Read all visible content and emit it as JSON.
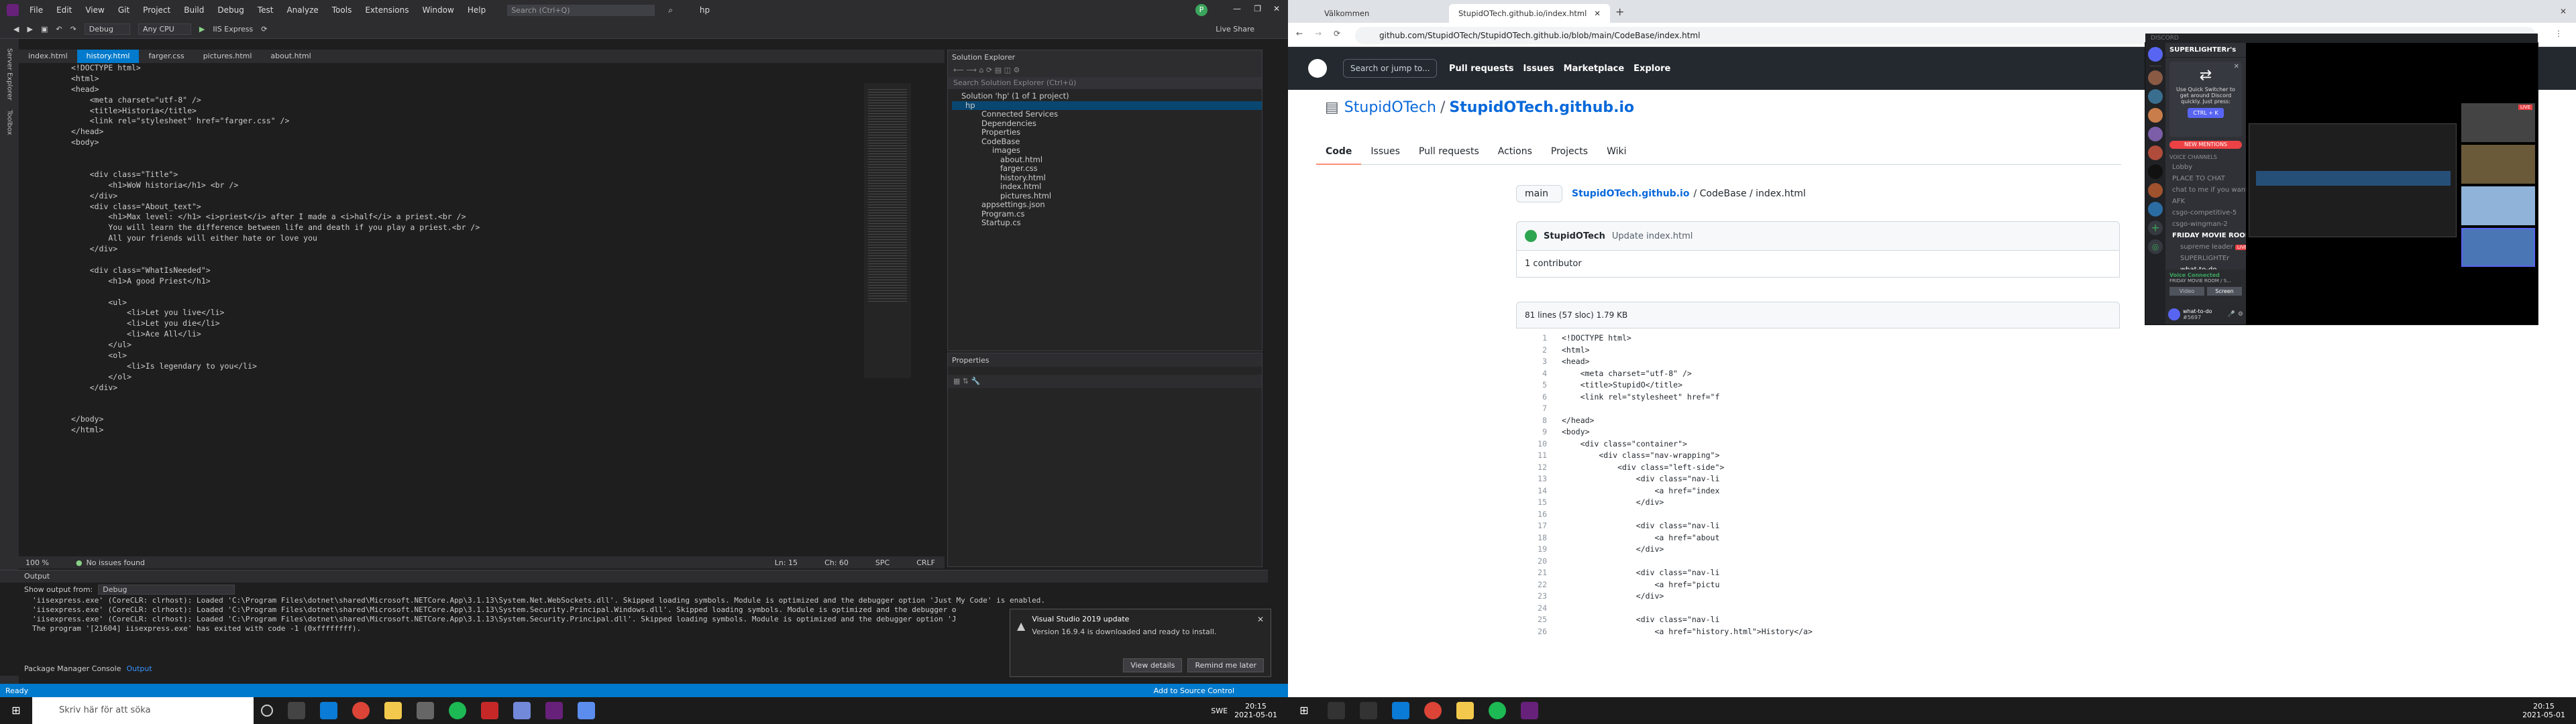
{
  "vs": {
    "menu": [
      "File",
      "Edit",
      "View",
      "Git",
      "Project",
      "Build",
      "Debug",
      "Test",
      "Analyze",
      "Tools",
      "Extensions",
      "Window",
      "Help"
    ],
    "search_placeholder": "Search (Ctrl+Q)",
    "solution_name": "hp",
    "toolbar": {
      "config": "Debug",
      "platform": "Any CPU",
      "run": "IIS Express",
      "live_share": "Live Share"
    },
    "side_tabs": [
      "Server Explorer",
      "Toolbox"
    ],
    "tabs": [
      "index.html",
      "history.html",
      "farger.css",
      "pictures.html",
      "about.html"
    ],
    "code_lines": [
      "<!DOCTYPE html>",
      "<html>",
      "<head>",
      "    <meta charset=\"utf-8\" />",
      "    <title>Historia</title>",
      "    <link rel=\"stylesheet\" href=\"farger.css\" />",
      "</head>",
      "<body>",
      "",
      "",
      "    <div class=\"Title\">",
      "        <h1>WoW historia</h1> <br />",
      "    </div>",
      "    <div class=\"About_text\">",
      "        <h1>Max level: </h1> <i>priest</i> after I made a <i>half</i> a priest.<br />",
      "        You will learn the difference between life and death if you play a priest.<br />",
      "        All your friends will either hate or love you",
      "    </div>",
      "",
      "    <div class=\"WhatIsNeeded\">",
      "        <h1>A good Priest</h1>",
      "",
      "        <ul>",
      "            <li>Let you live</li>",
      "            <li>Let you die</li>",
      "            <li>Ace All</li>",
      "        </ul>",
      "        <ol>",
      "            <li>Is legendary to you</li>",
      "        </ol>",
      "    </div>",
      "",
      "",
      "</body>",
      "</html>"
    ],
    "editor_status": {
      "zoom": "100 %",
      "issues": "No issues found",
      "ln": "Ln: 15",
      "ch": "Ch: 60",
      "spc": "SPC",
      "crlf": "CRLF"
    },
    "solution_explorer": {
      "title": "Solution Explorer",
      "search": "Search Solution Explorer (Ctrl+ü)",
      "items": [
        "Solution 'hp' (1 of 1 project)",
        "hp",
        "Connected Services",
        "Dependencies",
        "Properties",
        "CodeBase",
        "images",
        "about.html",
        "farger.css",
        "history.html",
        "index.html",
        "pictures.html",
        "appsettings.json",
        "Program.cs",
        "Startup.cs"
      ]
    },
    "properties_title": "Properties",
    "output": {
      "title": "Output",
      "show_from_label": "Show output from:",
      "show_from_value": "Debug",
      "lines": [
        "'iisexpress.exe' (CoreCLR: clrhost): Loaded 'C:\\Program Files\\dotnet\\shared\\Microsoft.NETCore.App\\3.1.13\\System.Net.WebSockets.dll'. Skipped loading symbols. Module is optimized and the debugger option 'Just My Code' is enabled.",
        "'iisexpress.exe' (CoreCLR: clrhost): Loaded 'C:\\Program Files\\dotnet\\shared\\Microsoft.NETCore.App\\3.1.13\\System.Security.Principal.Windows.dll'. Skipped loading symbols. Module is optimized and the debugger o",
        "'iisexpress.exe' (CoreCLR: clrhost): Loaded 'C:\\Program Files\\dotnet\\shared\\Microsoft.NETCore.App\\3.1.13\\System.Security.Principal.dll'. Skipped loading symbols. Module is optimized and the debugger option 'J",
        "The program '[21604] iisexpress.exe' has exited with code -1 (0xffffffff)."
      ],
      "bottom_tabs": [
        "Package Manager Console",
        "Output"
      ]
    },
    "toast": {
      "title": "Visual Studio 2019 update",
      "body": "Version 16.9.4 is downloaded and ready to install.",
      "details": "View details",
      "later": "Remind me later"
    },
    "statusbar": {
      "ready": "Ready",
      "source_control": "Add to Source Control"
    },
    "taskbar": {
      "search": "Skriv här för att söka",
      "time": "20:15",
      "date": "2021-05-01",
      "lang": "SWE"
    }
  },
  "browser": {
    "tabs": [
      "Välkommen",
      "StupidOTech.github.io/index.html"
    ],
    "url": "github.com/StupidOTech/StupidOTech.github.io/blob/main/CodeBase/index.html",
    "gh": {
      "search": "Search or jump to...",
      "nav": [
        "Pull requests",
        "Issues",
        "Marketplace",
        "Explore"
      ],
      "owner": "StupidOTech",
      "repo": "StupidOTech.github.io",
      "tabs": [
        "Code",
        "Issues",
        "Pull requests",
        "Actions",
        "Projects",
        "Wiki"
      ],
      "branch": "main",
      "path_repo": "StupidOTech.github.io",
      "path_rest": "/ CodeBase / index.html",
      "commit_user": "StupidOTech",
      "commit_msg": "Update index.html",
      "contributors": "1 contributor",
      "file_info": "81 lines (57 sloc)   1.79 KB",
      "code": [
        "<!DOCTYPE html>",
        "<html>",
        "<head>",
        "    <meta charset=\"utf-8\" />",
        "    <title>StupidO</title>",
        "    <link rel=\"stylesheet\" href=\"f",
        "",
        "</head>",
        "<body>",
        "    <div class=\"container\">",
        "        <div class=\"nav-wrapping\">",
        "            <div class=\"left-side\">",
        "                <div class=\"nav-li",
        "                    <a href=\"index",
        "                </div>",
        "",
        "                <div class=\"nav-li",
        "                    <a href=\"about",
        "                </div>",
        "",
        "                <div class=\"nav-li",
        "                    <a href=\"pictu",
        "                </div>",
        "",
        "                <div class=\"nav-li",
        "                    <a href=\"history.html\">History</a>"
      ]
    },
    "taskbar": {
      "time": "20:15",
      "date": "2021-05-01"
    }
  },
  "discord": {
    "brand": "DISCORD",
    "server": "SUPERLIGHTERr's server",
    "quick_switcher": "Use Quick Switcher to get around Discord quickly. Just press:",
    "shortcut": "CTRL + K",
    "new_mentions": "NEW MENTIONS",
    "voice_header": "VOICE CHANNELS",
    "channels": [
      "Lobby",
      "PLACE TO CHAT",
      "chat to me if you want to...",
      "AFK",
      "csgo-competitive-5",
      "csgo-wingman-2",
      "FRIDAY MOVIE ROOM"
    ],
    "members": [
      "supreme leader",
      "SUPERLIGHTEr",
      "what-to-do"
    ],
    "live": "LIVE",
    "voice_connected": "Voice Connected",
    "voice_room": "FRIDAY MOVIE ROOM / S...",
    "video": "Video",
    "screen": "Screen",
    "user": "what-to-do",
    "user_tag": "#5697"
  }
}
